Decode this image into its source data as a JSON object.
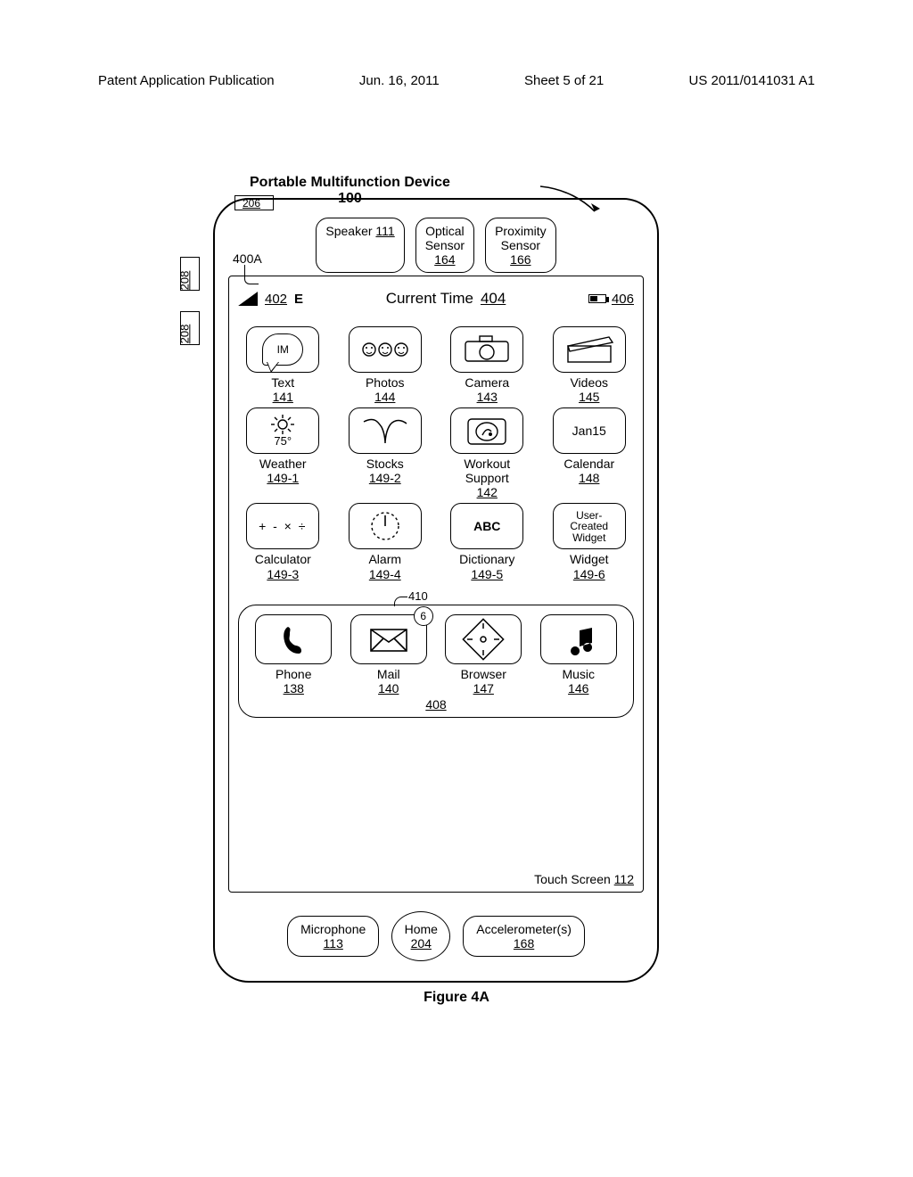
{
  "header": {
    "left": "Patent Application Publication",
    "date": "Jun. 16, 2011",
    "sheet": "Sheet 5 of 21",
    "pubno": "US 2011/0141031 A1"
  },
  "title": "Portable Multifunction Device",
  "device_ref": "100",
  "sim_ref": "206",
  "side_refs": {
    "a": "208",
    "b": "208"
  },
  "top_components": {
    "speaker": {
      "label": "Speaker",
      "ref": "111"
    },
    "optical": {
      "label": "Optical\nSensor",
      "ref": "164"
    },
    "proximity": {
      "label": "Proximity\nSensor",
      "ref": "166"
    }
  },
  "screen_label": "400A",
  "status": {
    "signal_ref": "402",
    "carrier_letter": "E",
    "time_label": "Current Time",
    "time_ref": "404",
    "battery_ref": "406"
  },
  "apps": {
    "row1": [
      {
        "icon": "im-speech",
        "icon_text": "IM",
        "label": "Text",
        "ref": "141"
      },
      {
        "icon": "photos-faces",
        "label": "Photos",
        "ref": "144"
      },
      {
        "icon": "camera",
        "label": "Camera",
        "ref": "143"
      },
      {
        "icon": "clapper",
        "label": "Videos",
        "ref": "145"
      }
    ],
    "row2": [
      {
        "icon": "weather",
        "icon_text": "75°",
        "label": "Weather",
        "ref": "149-1"
      },
      {
        "icon": "stocks",
        "label": "Stocks",
        "ref": "149-2"
      },
      {
        "icon": "workout",
        "label": "Workout\nSupport",
        "ref": "142"
      },
      {
        "icon": "calendar",
        "icon_text_top": "Jan",
        "icon_text_bottom": "15",
        "label": "Calendar",
        "ref": "148"
      }
    ],
    "row3": [
      {
        "icon": "math",
        "icon_text": "+ - × ÷",
        "label": "Calculator",
        "ref": "149-3"
      },
      {
        "icon": "alarm",
        "label": "Alarm",
        "ref": "149-4"
      },
      {
        "icon": "abc",
        "icon_text": "ABC",
        "label": "Dictionary",
        "ref": "149-5"
      },
      {
        "icon": "user-widget",
        "icon_text": "User-\nCreated\nWidget",
        "label": "Widget",
        "ref": "149-6"
      }
    ]
  },
  "dock": {
    "ref": "408",
    "badge_ref": "410",
    "badge_value": "6",
    "apps": [
      {
        "icon": "phone",
        "label": "Phone",
        "ref": "138"
      },
      {
        "icon": "mail",
        "label": "Mail",
        "ref": "140",
        "badge": true
      },
      {
        "icon": "browser",
        "label": "Browser",
        "ref": "147"
      },
      {
        "icon": "music",
        "label": "Music",
        "ref": "146"
      }
    ]
  },
  "touch_screen": {
    "label": "Touch Screen",
    "ref": "112"
  },
  "bottom_components": {
    "mic": {
      "label": "Microphone",
      "ref": "113"
    },
    "home": {
      "label": "Home",
      "ref": "204"
    },
    "accel": {
      "label": "Accelerometer(s)",
      "ref": "168"
    }
  },
  "figure_caption": "Figure 4A"
}
